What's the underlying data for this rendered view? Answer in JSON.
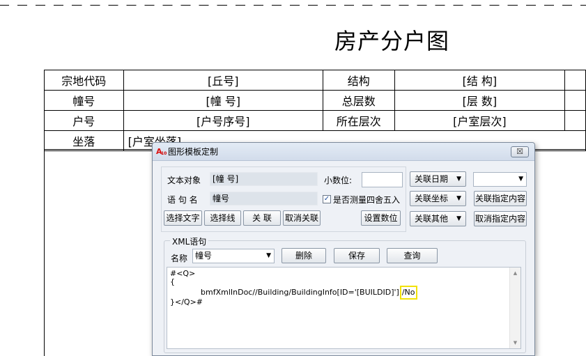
{
  "document": {
    "title": "房产分户图",
    "rows": [
      [
        "宗地代码",
        "[丘号]",
        "结构",
        "[结 构]"
      ],
      [
        "幢号",
        "[幢 号]",
        "总层数",
        "[层 数]"
      ],
      [
        "户号",
        "[户号序号]",
        "所在层次",
        "[户室层次]"
      ]
    ],
    "location_label": "坐落",
    "location_value": "[户室坐落]"
  },
  "dialog": {
    "title": "图形模板定制",
    "app_icon": "autocad-icon",
    "close_symbol": "☒",
    "text_object_label": "文本对象",
    "text_object_value": "[幢 号]",
    "statement_name_label": "语 句 名",
    "statement_name_value": "幢号",
    "decimals_label": "小数位:",
    "decimals_value": "",
    "round_checkbox_label": "是否测量四舍五入",
    "round_checked": true,
    "btn_select_text": "选择文字",
    "btn_select_line": "选择线",
    "btn_associate": "关 联",
    "btn_cancel_assoc": "取消关联",
    "btn_set_decimals": "设置数位",
    "btn_assoc_date": "关联日期",
    "btn_assoc_coord": "关联坐标",
    "btn_assoc_other": "关联其他",
    "date_combo_value": "",
    "btn_assoc_specified": "关联指定内容",
    "btn_cancel_specified": "取消指定内容",
    "xml_group_label": "XML语句",
    "xml_name_label": "名称",
    "xml_name_value": "幢号",
    "btn_delete": "删除",
    "btn_save": "保存",
    "btn_query": "查询",
    "xml_line1": "#<Q>",
    "xml_line2": "{",
    "xml_line3_main": "bmfXmlInDoc//Building/BuildingInfo[ID='[BUILDID]']",
    "xml_line3_highlight": "/No",
    "xml_line4": "}</Q>#"
  }
}
